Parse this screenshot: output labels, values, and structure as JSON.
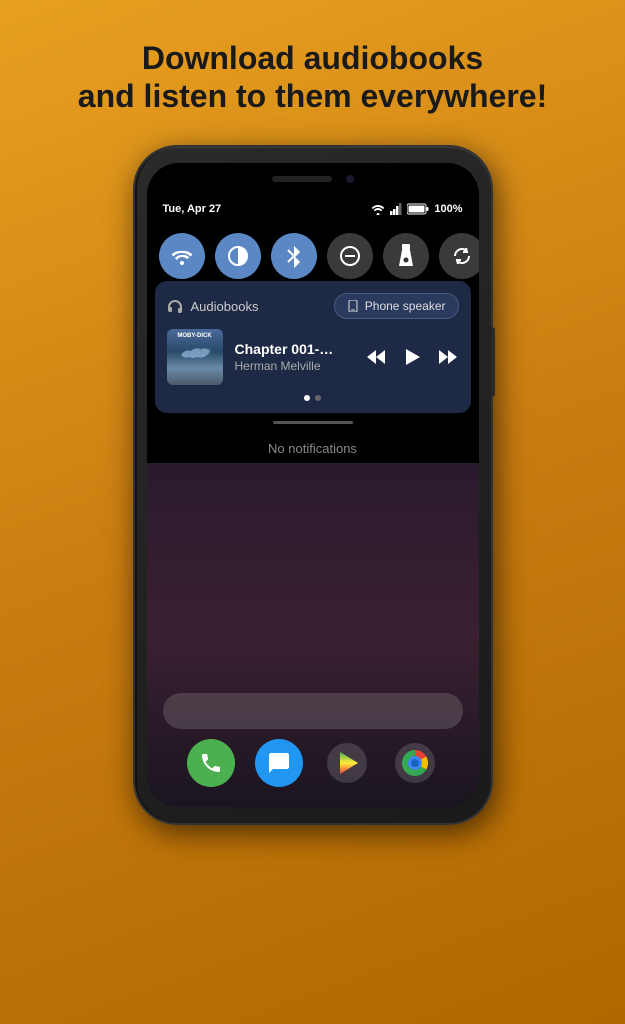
{
  "headline": {
    "line1": "Download audiobooks",
    "line2": "and listen to them everywhere!"
  },
  "status_bar": {
    "time": "Tue, Apr 27",
    "battery": "100%",
    "wifi": "▼",
    "signal": "▲"
  },
  "quick_settings": [
    {
      "id": "wifi",
      "label": "Wi-Fi",
      "icon": "wifi",
      "active": true
    },
    {
      "id": "display",
      "label": "Display",
      "icon": "circle-half",
      "active": true
    },
    {
      "id": "bluetooth",
      "label": "Bluetooth",
      "icon": "bluetooth",
      "active": true
    },
    {
      "id": "dnd",
      "label": "Do Not Disturb",
      "icon": "minus-circle",
      "active": false
    },
    {
      "id": "flashlight",
      "label": "Flashlight",
      "icon": "flashlight",
      "active": false
    },
    {
      "id": "rotate",
      "label": "Auto-rotate",
      "icon": "rotate",
      "active": false
    }
  ],
  "notification": {
    "app_name": "Audiobooks",
    "speaker_label": "Phone speaker",
    "track_name": "Chapter 001-…",
    "track_author": "Herman Melville",
    "book_title": "MOBY-DICK",
    "dots": [
      {
        "active": true
      },
      {
        "active": false
      }
    ]
  },
  "no_notifications": "No notifications",
  "dock": [
    {
      "label": "Phone",
      "icon": "📞"
    },
    {
      "label": "Messages",
      "icon": "💬"
    },
    {
      "label": "Play Store",
      "icon": "▶"
    },
    {
      "label": "Chrome",
      "icon": "●"
    }
  ]
}
